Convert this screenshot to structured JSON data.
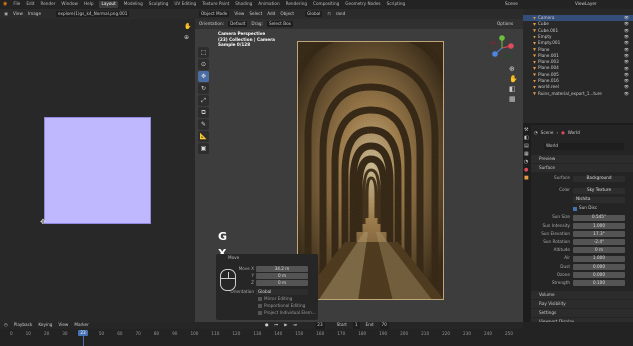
{
  "topbar": {
    "menus": [
      "File",
      "Edit",
      "Render",
      "Window",
      "Help"
    ],
    "tabs": [
      "Layout",
      "Modeling",
      "Sculpting",
      "UV Editing",
      "Texture Paint",
      "Shading",
      "Animation",
      "Rendering",
      "Compositing",
      "Geometry Nodes",
      "Scripting"
    ],
    "active_tab": "Layout",
    "scene_label": "Scene",
    "view_layer_label": "ViewLayer"
  },
  "image_editor": {
    "menus": [
      "View",
      "Image"
    ],
    "image_name": "explore(1)gs_k4_Normal.png.001"
  },
  "viewport": {
    "header": {
      "mode": "Object Mode",
      "menus": [
        "View",
        "Select",
        "Add",
        "Object"
      ],
      "orientation": "Global",
      "overlay_text": "rand"
    },
    "secondary_header": {
      "orientation_label": "Orientation:",
      "orientation_value": "Default",
      "drag_label": "Drag:",
      "drag_value": "Select Box",
      "options": "Options"
    },
    "info": {
      "line1": "Camera Perspective",
      "line2": "(23) Collection | Camera",
      "line3": "Sample 0/128"
    },
    "key_g": "G",
    "key_x": "X",
    "operator_panel": {
      "title": "Move",
      "move_x_label": "Move X",
      "move_x": "34.2 m",
      "y_label": "Y",
      "y": "0 m",
      "z_label": "Z",
      "z": "0 m",
      "orientation_label": "Orientation",
      "orientation": "Global",
      "checkboxes": [
        "Mirror Editing",
        "Proportional Editing",
        "Project Individual Elem..."
      ]
    }
  },
  "outliner": {
    "items": [
      {
        "name": "Camera",
        "selected": true
      },
      {
        "name": "Cube",
        "selected": false
      },
      {
        "name": "Cube.001",
        "selected": false
      },
      {
        "name": "Empty",
        "selected": false
      },
      {
        "name": "Empty.001",
        "selected": false
      },
      {
        "name": "Plane",
        "selected": false
      },
      {
        "name": "Plane.001",
        "selected": false
      },
      {
        "name": "Plane.003",
        "selected": false
      },
      {
        "name": "Plane.004",
        "selected": false
      },
      {
        "name": "Plane.005",
        "selected": false
      },
      {
        "name": "Plane.016",
        "selected": false
      },
      {
        "name": "world.reel",
        "selected": false
      },
      {
        "name": "Ruins_material_export_1...ture",
        "selected": false
      }
    ]
  },
  "properties": {
    "breadcrumb_scene": "Scene",
    "breadcrumb_world": "World",
    "world_name": "World",
    "sections": {
      "preview": "Preview",
      "surface": "Surface",
      "volume": "Volume",
      "ray_visibility": "Ray Visibility",
      "settings": "Settings",
      "viewport_display": "Viewport Display",
      "custom_properties": "Custom Properties"
    },
    "surface_label": "Surface",
    "surface_value": "Background",
    "color_label": "Color",
    "color_value": "Sky Texture",
    "sky_type": "Nishita",
    "sun_disc_label": "Sun Disc",
    "rows": [
      {
        "label": "Sun Size",
        "value": "0.545°"
      },
      {
        "label": "Sun Intensity",
        "value": "1.000"
      },
      {
        "label": "Sun Elevation",
        "value": "17.3°"
      },
      {
        "label": "Sun Rotation",
        "value": "-2.4°"
      },
      {
        "label": "Altitude",
        "value": "0 m"
      },
      {
        "label": "Air",
        "value": "1.000"
      },
      {
        "label": "Dust",
        "value": "0.000"
      },
      {
        "label": "Ozone",
        "value": "0.000"
      },
      {
        "label": "Strength",
        "value": "0.100"
      }
    ]
  },
  "timeline": {
    "menus": [
      "Playback",
      "Keying",
      "View",
      "Marker"
    ],
    "current_frame": "23",
    "start_label": "Start",
    "start": "1",
    "end_label": "End",
    "end": "70",
    "ruler": [
      "0",
      "10",
      "20",
      "30",
      "40",
      "50",
      "60",
      "70",
      "80",
      "90",
      "100",
      "110",
      "120",
      "130",
      "140",
      "150",
      "160",
      "170",
      "180",
      "190",
      "200",
      "210",
      "220",
      "230",
      "240",
      "250"
    ]
  }
}
